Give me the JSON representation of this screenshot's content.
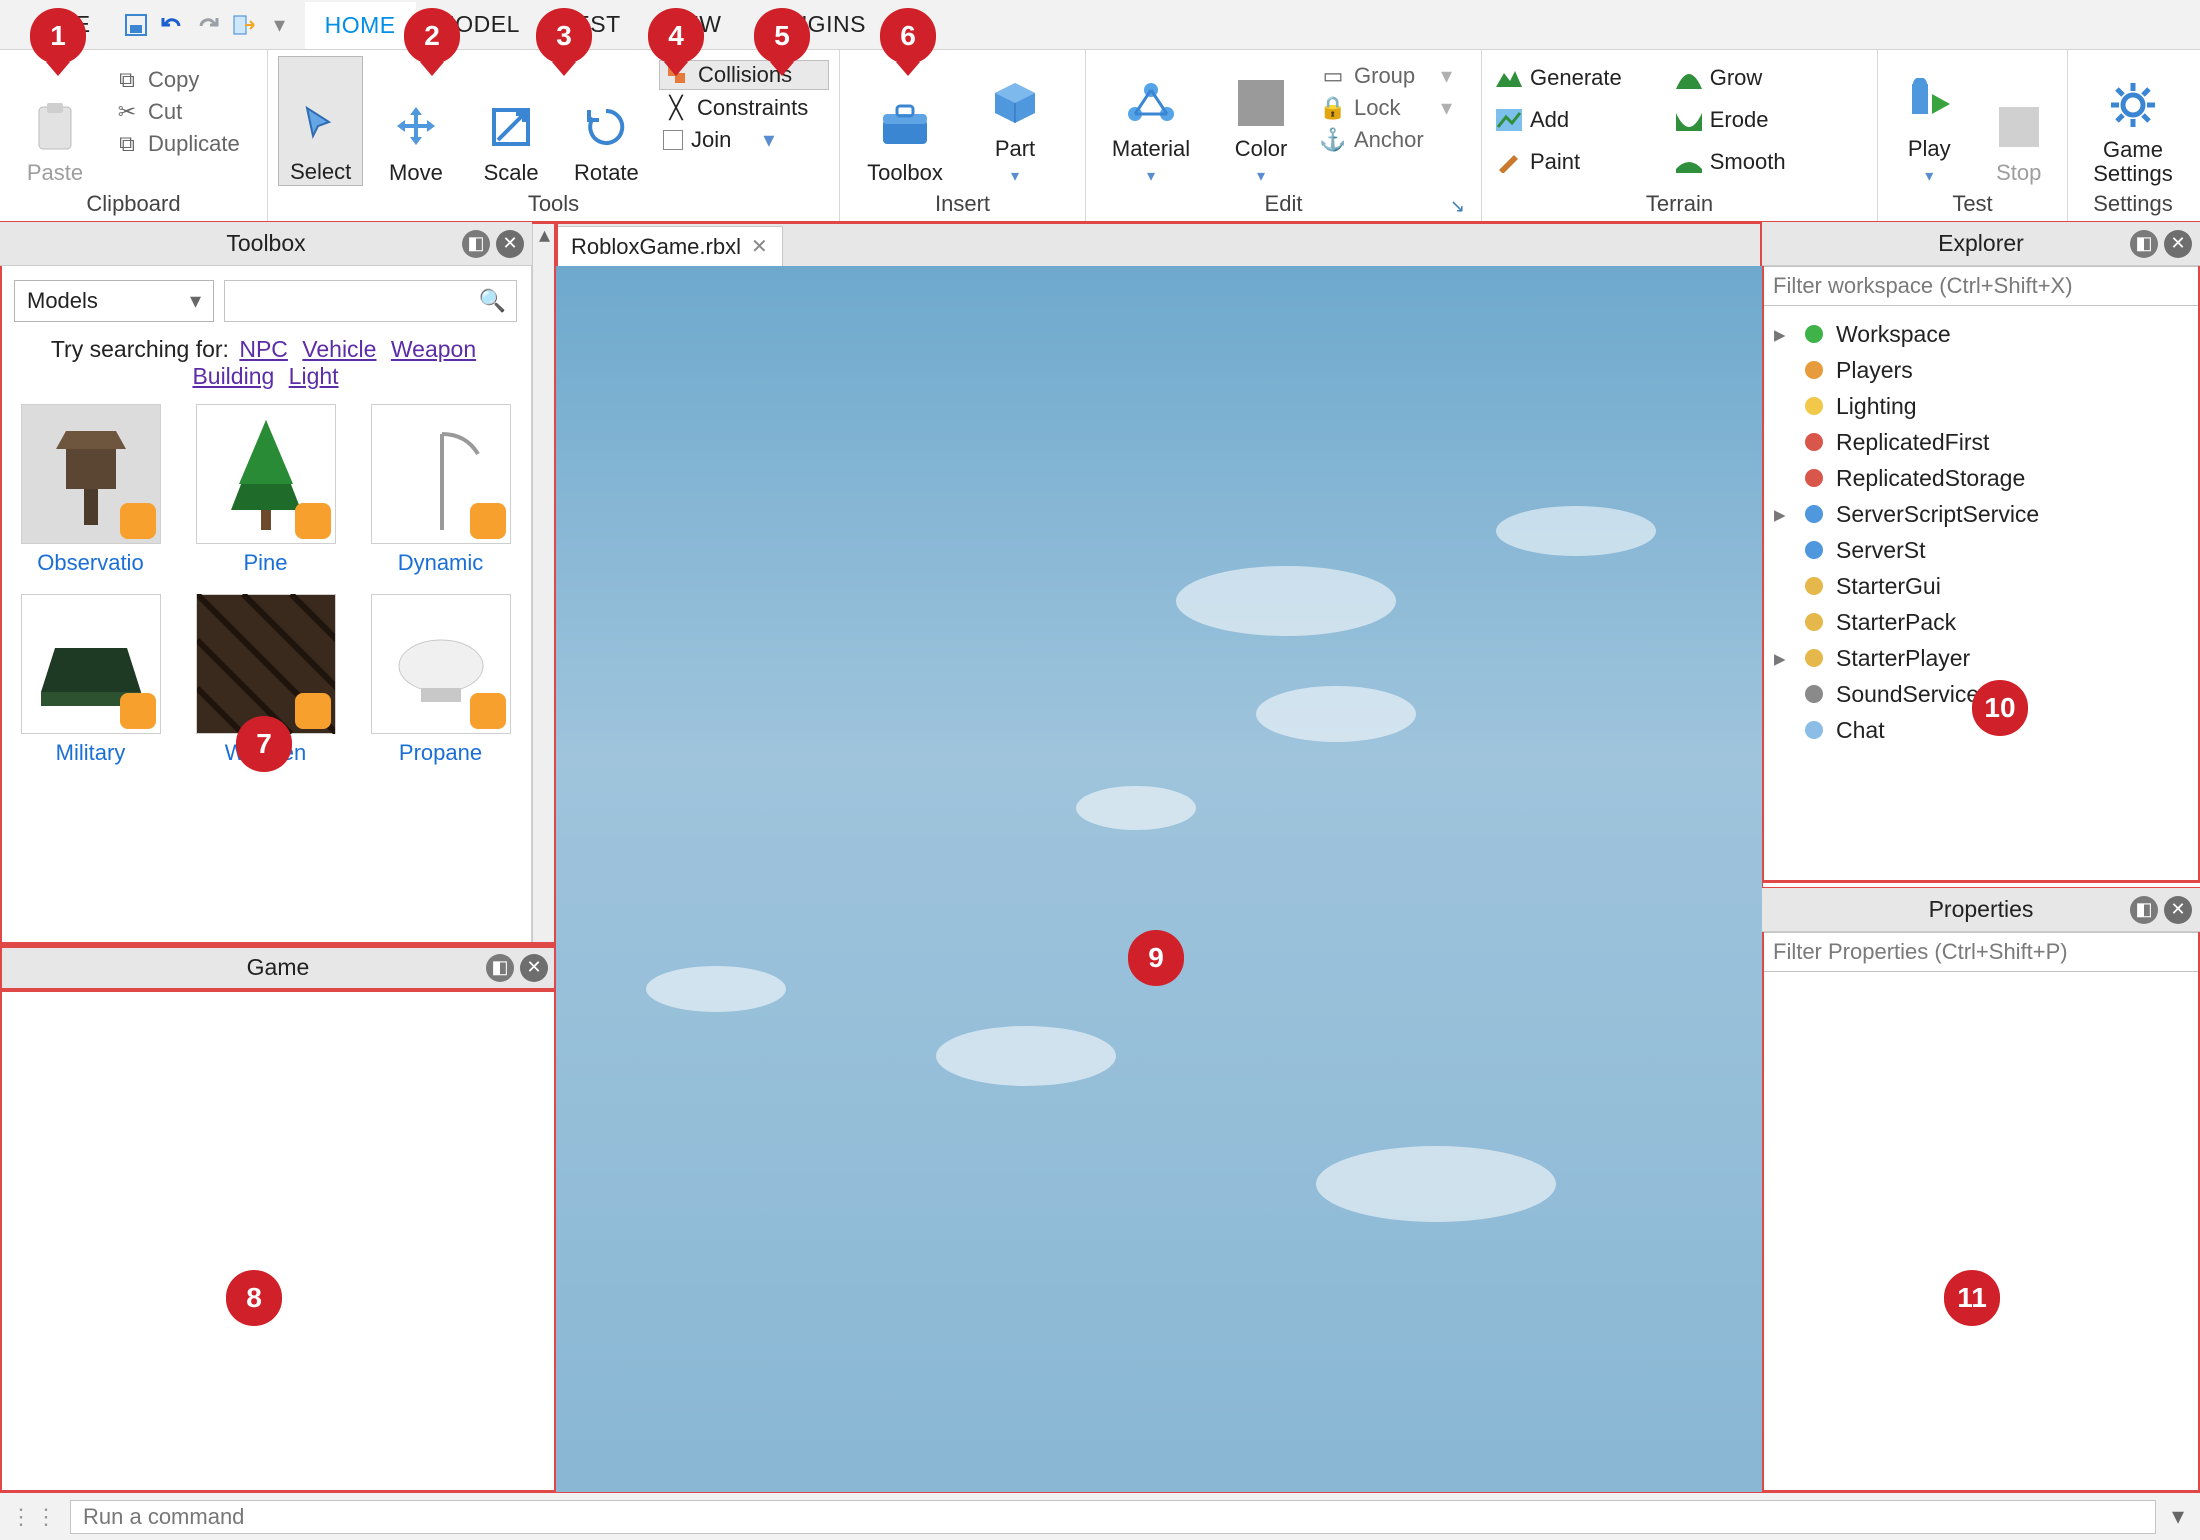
{
  "menubar": {
    "file": "FILE",
    "home": "HOME",
    "model": "MODEL",
    "test": "TEST",
    "view": "VIEW",
    "plugins": "PLUGINS"
  },
  "ribbon": {
    "clipboard": {
      "paste": "Paste",
      "copy": "Copy",
      "cut": "Cut",
      "duplicate": "Duplicate",
      "label": "Clipboard"
    },
    "tools": {
      "select": "Select",
      "move": "Move",
      "scale": "Scale",
      "rotate": "Rotate",
      "collisions": "Collisions",
      "constraints": "Constraints",
      "join": "Join",
      "label": "Tools"
    },
    "insert": {
      "toolbox": "Toolbox",
      "part": "Part",
      "label": "Insert"
    },
    "edit": {
      "material": "Material",
      "color": "Color",
      "group": "Group",
      "lock": "Lock",
      "anchor": "Anchor",
      "label": "Edit"
    },
    "terrain": {
      "generate": "Generate",
      "add": "Add",
      "paint": "Paint",
      "grow": "Grow",
      "erode": "Erode",
      "smooth": "Smooth",
      "label": "Terrain"
    },
    "test": {
      "play": "Play",
      "stop": "Stop",
      "label": "Test"
    },
    "settings": {
      "game_settings": "Game Settings",
      "label": "Settings"
    }
  },
  "toolbox": {
    "title": "Toolbox",
    "dropdown": "Models",
    "suggest_prefix": "Try searching for:",
    "suggest_links": [
      "NPC",
      "Vehicle",
      "Weapon",
      "Building",
      "Light"
    ],
    "models": [
      "Observatio",
      "Pine",
      "Dynamic",
      "Military",
      "Wooden",
      "Propane"
    ]
  },
  "game_panel": {
    "title": "Game"
  },
  "doc_tab": {
    "name": "RobloxGame.rbxl"
  },
  "explorer": {
    "title": "Explorer",
    "filter_placeholder": "Filter workspace (Ctrl+Shift+X)",
    "items": [
      {
        "label": "Workspace",
        "expandable": true
      },
      {
        "label": "Players",
        "expandable": false
      },
      {
        "label": "Lighting",
        "expandable": false
      },
      {
        "label": "ReplicatedFirst",
        "expandable": false
      },
      {
        "label": "ReplicatedStorage",
        "expandable": false
      },
      {
        "label": "ServerScriptService",
        "expandable": true
      },
      {
        "label": "ServerSt",
        "expandable": false
      },
      {
        "label": "StarterGui",
        "expandable": false
      },
      {
        "label": "StarterPack",
        "expandable": false
      },
      {
        "label": "StarterPlayer",
        "expandable": true
      },
      {
        "label": "SoundService",
        "expandable": false
      },
      {
        "label": "Chat",
        "expandable": false
      }
    ]
  },
  "properties": {
    "title": "Properties",
    "filter_placeholder": "Filter Properties (Ctrl+Shift+P)"
  },
  "cmdbar": {
    "placeholder": "Run a command"
  },
  "callouts": [
    "1",
    "2",
    "3",
    "4",
    "5",
    "6",
    "7",
    "8",
    "9",
    "10",
    "11"
  ]
}
